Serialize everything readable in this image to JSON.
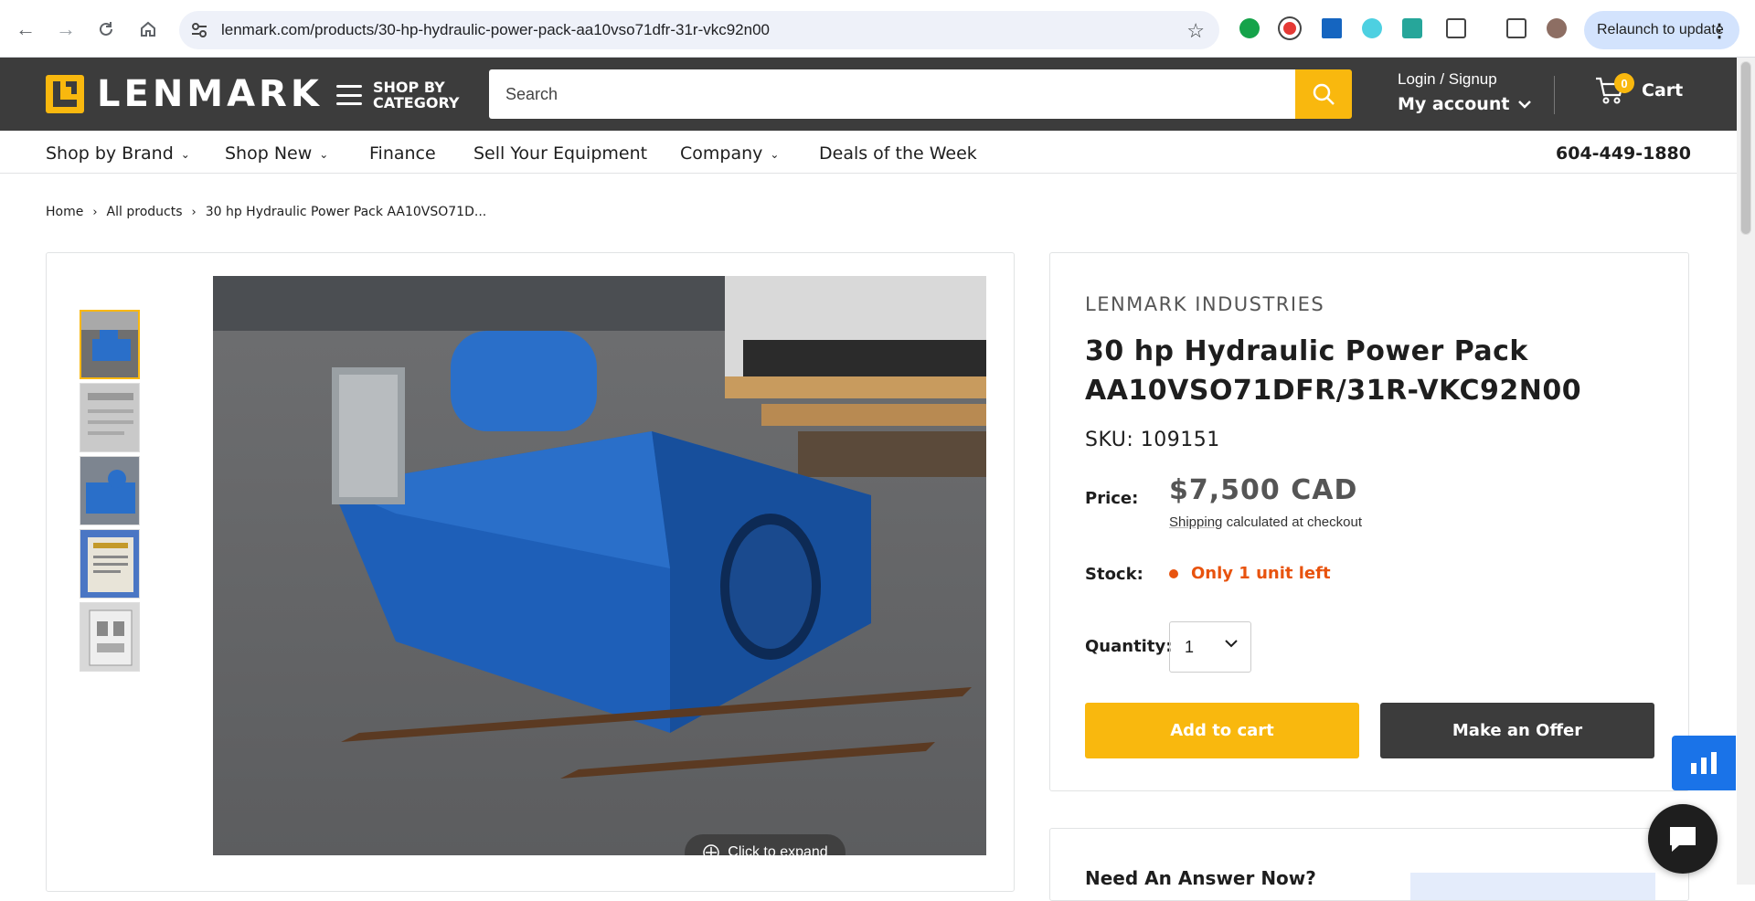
{
  "browser": {
    "url": "lenmark.com/products/30-hp-hydraulic-power-pack-aa10vso71dfr-31r-vkc92n00",
    "relaunch_label": "Relaunch to update"
  },
  "header": {
    "logo_text": "LENMARK",
    "shop_by_category": "SHOP BY CATEGORY",
    "search_placeholder": "Search",
    "login_signup": "Login / Signup",
    "my_account": "My account",
    "cart_count": "0",
    "cart_label": "Cart"
  },
  "nav": {
    "items": [
      {
        "label": "Shop by Brand",
        "has_dropdown": true
      },
      {
        "label": "Shop New",
        "has_dropdown": true
      },
      {
        "label": "Finance",
        "has_dropdown": false
      },
      {
        "label": "Sell Your Equipment",
        "has_dropdown": false
      },
      {
        "label": "Company",
        "has_dropdown": true
      },
      {
        "label": "Deals of the Week",
        "has_dropdown": false
      }
    ],
    "phone": "604-449-1880"
  },
  "breadcrumb": {
    "home": "Home",
    "all_products": "All products",
    "current": "30 hp Hydraulic Power Pack AA10VSO71D..."
  },
  "gallery": {
    "thumbnail_count": 5,
    "active_index": 0,
    "expand_label": "Click to expand"
  },
  "product": {
    "vendor": "LENMARK INDUSTRIES",
    "title": "30 hp Hydraulic Power Pack AA10VSO71DFR/31R-VKC92N00",
    "sku": "SKU: 109151",
    "price_label": "Price:",
    "price": "$7,500 CAD",
    "shipping_link": "Shipping",
    "shipping_rest": "calculated at checkout",
    "stock_label": "Stock:",
    "stock_status": "Only 1 unit left",
    "quantity_label": "Quantity:",
    "quantity_value": "1",
    "add_to_cart": "Add to cart",
    "make_offer": "Make an Offer"
  },
  "answer": {
    "heading": "Need An Answer Now?"
  },
  "colors": {
    "accent": "#f9b80e",
    "header_bg": "#3c3c3c",
    "stock_alert": "#e8530e",
    "product_blue": "#2a6fc9"
  }
}
